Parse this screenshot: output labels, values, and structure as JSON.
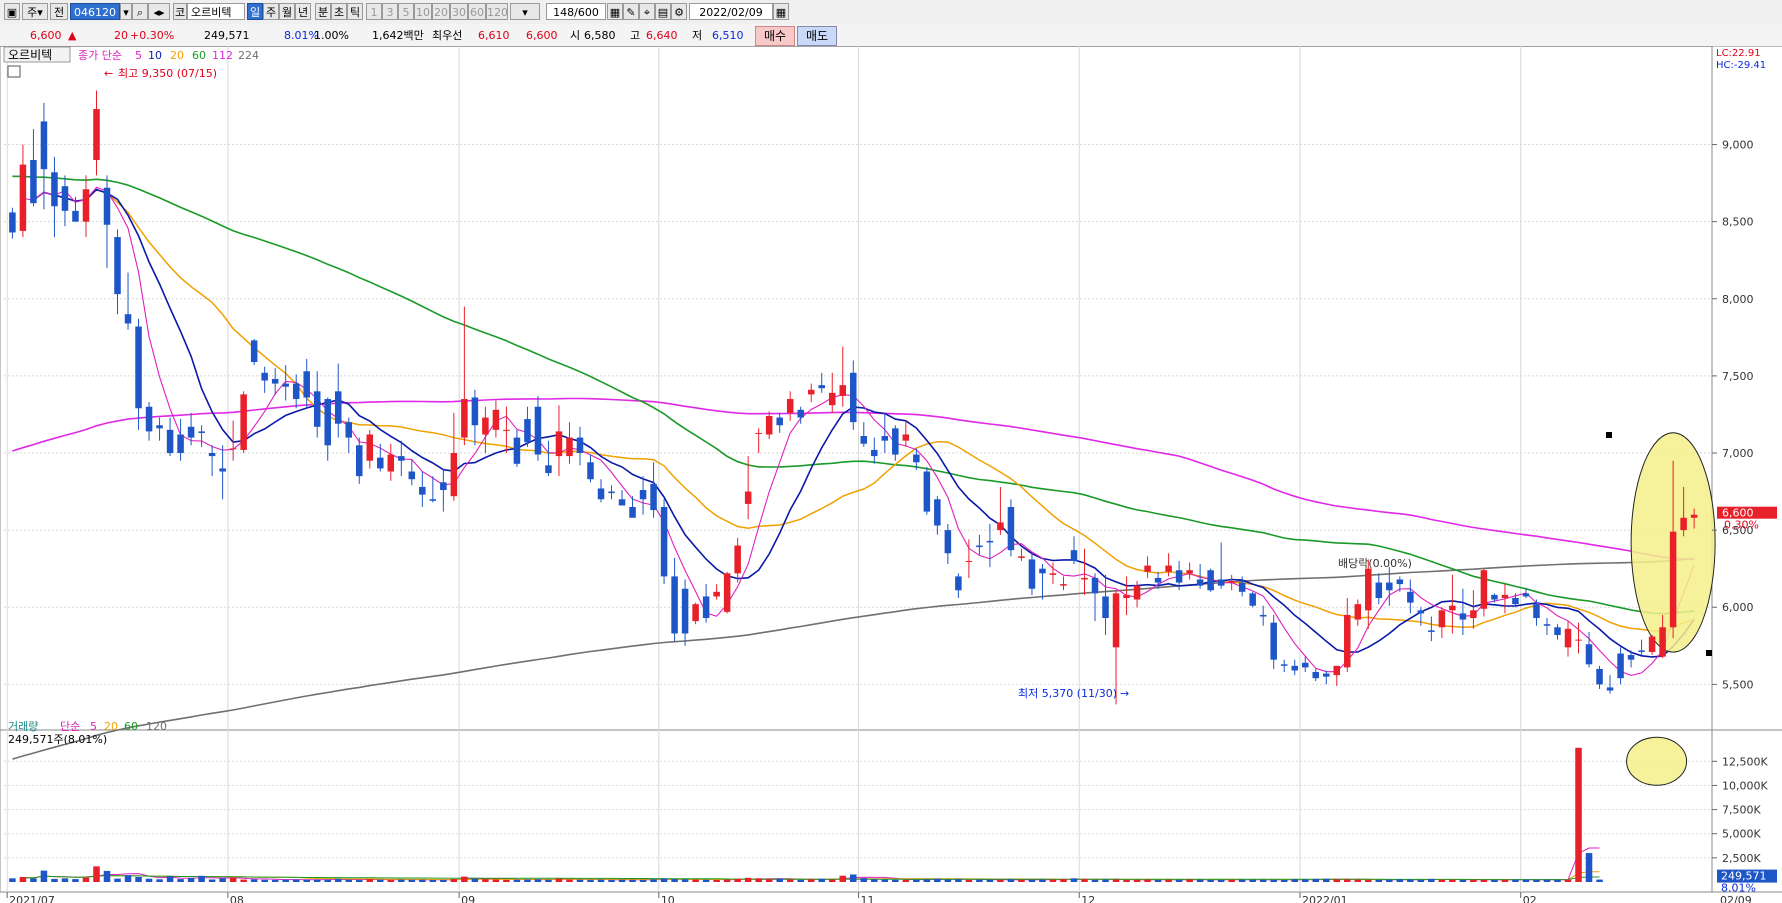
{
  "toolbar": {
    "period_type": "주",
    "market": "전",
    "code": "046120",
    "name_prefix": "코",
    "name": "오르비텍",
    "tabs": [
      "일",
      "주",
      "월",
      "년",
      "분",
      "초",
      "틱"
    ],
    "intervals": [
      "1",
      "3",
      "5",
      "10",
      "20",
      "30",
      "60",
      "120"
    ],
    "count": "148",
    "count_total": "/600",
    "date": "2022/02/09"
  },
  "quote": {
    "price": "6,600",
    "arrow": "▲",
    "change": "20",
    "change_pct": "+0.30%",
    "volume": "249,571",
    "turnover": "8.01%",
    "ratio": "1.00%",
    "amount": "1,642백만",
    "bid_label": "최우선",
    "bid1": "6,610",
    "bid2": "6,600",
    "open_label": "시",
    "open": "6,580",
    "high_label": "고",
    "high": "6,640",
    "low_label": "저",
    "low": "6,510",
    "buy": "매수",
    "sell": "매도"
  },
  "colors": {
    "up": "#e8202a",
    "down": "#1e56c8",
    "ma5": "#e020c0",
    "ma10": "#0a1aa8",
    "ma20": "#f0a000",
    "ma60": "#1a9a28",
    "ma112": "#e028e8",
    "ma224": "#707070",
    "grid": "#d8d8d8",
    "highlight": "#f4f08a"
  },
  "chart_data": [
    {
      "type": "candlestick",
      "title": "오르비텍",
      "legend_prefix": "종가 단순",
      "legend": [
        "5",
        "10",
        "20",
        "60",
        "112",
        "224"
      ],
      "y_ticks": [
        5500,
        6000,
        6500,
        7000,
        7500,
        8000,
        8500,
        9000
      ],
      "y_tick_labels": [
        "5,500",
        "6,000",
        "6,500",
        "7,000",
        "7,500",
        "8,000",
        "8,500",
        "9,000"
      ],
      "ylim": [
        5230,
        9600
      ],
      "x_labels": [
        "2021/07",
        "08",
        "09",
        "10",
        "11",
        "12",
        "2022/01",
        "02",
        "02/09"
      ],
      "x_label_index": [
        0,
        21,
        43,
        62,
        81,
        102,
        123,
        144
      ],
      "high_annotation": "최고 9,350 (07/15)",
      "low_annotation": "최저 5,370 (11/30)",
      "dividend_annotation": "배당락(0.00%)",
      "top_right": [
        "LC:22.91",
        "HC:-29.41"
      ],
      "last_price_label": "6,600",
      "last_change_label": "0.30%",
      "candles": [
        [
          8560,
          8590,
          8390,
          8430
        ],
        [
          8440,
          9000,
          8400,
          8870
        ],
        [
          8900,
          9100,
          8600,
          8620
        ],
        [
          9150,
          9270,
          8580,
          8840
        ],
        [
          8820,
          8920,
          8400,
          8600
        ],
        [
          8730,
          8800,
          8470,
          8570
        ],
        [
          8570,
          8660,
          8500,
          8500
        ],
        [
          8500,
          8800,
          8400,
          8710
        ],
        [
          8900,
          9350,
          8800,
          9230
        ],
        [
          8720,
          8800,
          8200,
          8480
        ],
        [
          8400,
          8450,
          7900,
          8030
        ],
        [
          7900,
          8170,
          7800,
          7840
        ],
        [
          7820,
          7870,
          7150,
          7290
        ],
        [
          7300,
          7330,
          7080,
          7140
        ],
        [
          7180,
          7230,
          7080,
          7160
        ],
        [
          7150,
          7230,
          6980,
          7000
        ],
        [
          7120,
          7220,
          6950,
          7000
        ],
        [
          7170,
          7260,
          7050,
          7100
        ],
        [
          7140,
          7180,
          7040,
          7130
        ],
        [
          7000,
          7050,
          6850,
          6980
        ],
        [
          6900,
          7050,
          6700,
          6880
        ],
        [
          7030,
          7210,
          6950,
          7030
        ],
        [
          7020,
          7400,
          7000,
          7380
        ],
        [
          7730,
          7740,
          7570,
          7590
        ],
        [
          7520,
          7560,
          7390,
          7470
        ],
        [
          7480,
          7550,
          7380,
          7450
        ],
        [
          7450,
          7570,
          7340,
          7430
        ],
        [
          7450,
          7510,
          7290,
          7350
        ],
        [
          7530,
          7610,
          7290,
          7360
        ],
        [
          7400,
          7530,
          7100,
          7170
        ],
        [
          7350,
          7360,
          6950,
          7050
        ],
        [
          7400,
          7580,
          7100,
          7190
        ],
        [
          7200,
          7230,
          7000,
          7100
        ],
        [
          7050,
          7100,
          6800,
          6850
        ],
        [
          6950,
          7150,
          6900,
          7120
        ],
        [
          6970,
          7060,
          6880,
          6900
        ],
        [
          6880,
          7060,
          6820,
          6990
        ],
        [
          6980,
          7080,
          6850,
          6950
        ],
        [
          6880,
          6960,
          6790,
          6830
        ],
        [
          6780,
          6880,
          6650,
          6730
        ],
        [
          6700,
          6850,
          6680,
          6690
        ],
        [
          6810,
          6900,
          6620,
          6760
        ],
        [
          6720,
          7260,
          6690,
          7000
        ],
        [
          7100,
          7950,
          7050,
          7350
        ],
        [
          7360,
          7410,
          7050,
          7180
        ],
        [
          7120,
          7300,
          7000,
          7230
        ],
        [
          7150,
          7340,
          7100,
          7280
        ],
        [
          7150,
          7300,
          7000,
          7150
        ],
        [
          7100,
          7150,
          6910,
          6930
        ],
        [
          7220,
          7300,
          7040,
          7070
        ],
        [
          7300,
          7370,
          6950,
          6990
        ],
        [
          6920,
          7080,
          6850,
          6870
        ],
        [
          6980,
          7310,
          6850,
          7140
        ],
        [
          6980,
          7200,
          6930,
          7100
        ],
        [
          7100,
          7170,
          6920,
          7000
        ],
        [
          6940,
          6990,
          6810,
          6830
        ],
        [
          6770,
          6830,
          6680,
          6700
        ],
        [
          6750,
          6790,
          6700,
          6740
        ],
        [
          6700,
          6760,
          6660,
          6660
        ],
        [
          6650,
          6720,
          6600,
          6580
        ],
        [
          6760,
          6850,
          6600,
          6700
        ],
        [
          6800,
          6940,
          6580,
          6630
        ],
        [
          6650,
          6700,
          6150,
          6200
        ],
        [
          6200,
          6320,
          5780,
          5830
        ],
        [
          6120,
          6180,
          5750,
          5830
        ],
        [
          5910,
          6030,
          5890,
          6020
        ],
        [
          6070,
          6150,
          5900,
          5930
        ],
        [
          6070,
          6150,
          6050,
          6100
        ],
        [
          5970,
          6230,
          5960,
          6220
        ],
        [
          6220,
          6450,
          6160,
          6400
        ],
        [
          6670,
          6980,
          6570,
          6750
        ],
        [
          7130,
          7160,
          7000,
          7130
        ],
        [
          7120,
          7270,
          7090,
          7240
        ],
        [
          7230,
          7260,
          7130,
          7180
        ],
        [
          7260,
          7400,
          7210,
          7350
        ],
        [
          7280,
          7300,
          7190,
          7230
        ],
        [
          7380,
          7450,
          7330,
          7410
        ],
        [
          7440,
          7520,
          7390,
          7420
        ],
        [
          7310,
          7520,
          7260,
          7390
        ],
        [
          7370,
          7690,
          7300,
          7440
        ],
        [
          7520,
          7600,
          7150,
          7200
        ],
        [
          7110,
          7200,
          7040,
          7060
        ],
        [
          7020,
          7100,
          6930,
          6980
        ],
        [
          7110,
          7260,
          7000,
          7080
        ],
        [
          7160,
          7180,
          6950,
          6990
        ],
        [
          7080,
          7210,
          7040,
          7120
        ],
        [
          6990,
          7030,
          6890,
          6940
        ],
        [
          6880,
          6910,
          6600,
          6620
        ],
        [
          6700,
          6720,
          6470,
          6530
        ],
        [
          6500,
          6540,
          6280,
          6350
        ],
        [
          6200,
          6220,
          6060,
          6110
        ],
        [
          6300,
          6440,
          6190,
          6300
        ],
        [
          6400,
          6470,
          6340,
          6390
        ],
        [
          6430,
          6540,
          6260,
          6420
        ],
        [
          6500,
          6780,
          6470,
          6550
        ],
        [
          6650,
          6700,
          6330,
          6370
        ],
        [
          6320,
          6380,
          6300,
          6330
        ],
        [
          6310,
          6350,
          6080,
          6120
        ],
        [
          6250,
          6280,
          6050,
          6220
        ],
        [
          6210,
          6290,
          6150,
          6220
        ],
        [
          6140,
          6200,
          6110,
          6150
        ],
        [
          6370,
          6460,
          6280,
          6300
        ],
        [
          6180,
          6380,
          6080,
          6190
        ],
        [
          6190,
          6220,
          5910,
          6090
        ],
        [
          6070,
          6210,
          5820,
          5930
        ],
        [
          5740,
          6110,
          5370,
          6090
        ],
        [
          6060,
          6200,
          5950,
          6080
        ],
        [
          6050,
          6170,
          6000,
          6140
        ],
        [
          6230,
          6330,
          6190,
          6270
        ],
        [
          6190,
          6230,
          6120,
          6160
        ],
        [
          6230,
          6350,
          6200,
          6270
        ],
        [
          6240,
          6300,
          6110,
          6160
        ],
        [
          6220,
          6290,
          6180,
          6240
        ],
        [
          6180,
          6280,
          6120,
          6140
        ],
        [
          6240,
          6250,
          6100,
          6110
        ],
        [
          6180,
          6420,
          6120,
          6140
        ],
        [
          6160,
          6210,
          6110,
          6170
        ],
        [
          6160,
          6200,
          6070,
          6100
        ],
        [
          6090,
          6100,
          6000,
          6010
        ],
        [
          5950,
          6010,
          5880,
          5940
        ],
        [
          5900,
          5950,
          5600,
          5660
        ],
        [
          5630,
          5660,
          5580,
          5620
        ],
        [
          5620,
          5660,
          5560,
          5590
        ],
        [
          5640,
          5680,
          5580,
          5610
        ],
        [
          5580,
          5600,
          5520,
          5540
        ],
        [
          5570,
          5590,
          5500,
          5550
        ],
        [
          5560,
          5620,
          5490,
          5620
        ],
        [
          5610,
          6060,
          5580,
          5950
        ],
        [
          5920,
          6050,
          5880,
          6020
        ],
        [
          5980,
          6310,
          5860,
          6250
        ],
        [
          6160,
          6220,
          6020,
          6060
        ],
        [
          6160,
          6260,
          6010,
          6110
        ],
        [
          6180,
          6200,
          6100,
          6150
        ],
        [
          6100,
          6180,
          5960,
          6030
        ],
        [
          5980,
          6000,
          5880,
          5960
        ],
        [
          5850,
          5940,
          5780,
          5840
        ],
        [
          5870,
          6000,
          5800,
          5980
        ],
        [
          5980,
          6210,
          5830,
          6010
        ],
        [
          5960,
          6120,
          5820,
          5920
        ],
        [
          5930,
          6110,
          5860,
          5980
        ],
        [
          5990,
          6250,
          5940,
          6240
        ],
        [
          6080,
          6090,
          6030,
          6050
        ],
        [
          6060,
          6150,
          5960,
          6080
        ],
        [
          6060,
          6090,
          6000,
          6020
        ],
        [
          6090,
          6120,
          6060,
          6070
        ],
        [
          6020,
          6050,
          5880,
          5930
        ],
        [
          5890,
          5930,
          5820,
          5880
        ],
        [
          5870,
          5890,
          5790,
          5820
        ],
        [
          5740,
          5910,
          5680,
          5860
        ],
        [
          5790,
          5900,
          5700,
          5790
        ],
        [
          5760,
          5840,
          5610,
          5630
        ],
        [
          5600,
          5620,
          5470,
          5500
        ],
        [
          5480,
          5560,
          5440,
          5460
        ],
        [
          5700,
          5740,
          5500,
          5540
        ],
        [
          5690,
          5720,
          5610,
          5660
        ],
        [
          5720,
          5790,
          5690,
          5710
        ],
        [
          5710,
          5820,
          5690,
          5810
        ],
        [
          5680,
          5950,
          5670,
          5870
        ],
        [
          5870,
          6950,
          5800,
          6490
        ],
        [
          6500,
          6780,
          6460,
          6580
        ],
        [
          6580,
          6640,
          6510,
          6600
        ]
      ]
    },
    {
      "type": "bar",
      "title": "거래량",
      "legend_prefix": "단순",
      "legend": [
        "5",
        "20",
        "60",
        "120"
      ],
      "current_label": "249,571주(8.01%)",
      "y_ticks": [
        2500,
        5000,
        7500,
        10000,
        12500
      ],
      "y_tick_labels": [
        "2,500K",
        "5,000K",
        "7,500K",
        "10,000K",
        "12,500K"
      ],
      "ylim": [
        0,
        14500
      ],
      "value_label": "249,571",
      "pct_label": "8.01%",
      "values": [
        380,
        520,
        380,
        1180,
        320,
        380,
        300,
        450,
        1620,
        1150,
        350,
        700,
        520,
        340,
        280,
        600,
        300,
        420,
        640,
        260,
        380,
        460,
        250,
        280,
        230,
        220,
        240,
        260,
        230,
        250,
        240,
        330,
        240,
        210,
        300,
        240,
        220,
        250,
        230,
        240,
        210,
        220,
        300,
        560,
        330,
        300,
        260,
        220,
        240,
        260,
        280,
        240,
        350,
        260,
        240,
        230,
        250,
        220,
        240,
        230,
        220,
        280,
        360,
        300,
        280,
        250,
        230,
        210,
        250,
        330,
        430,
        380,
        280,
        340,
        260,
        230,
        280,
        320,
        260,
        650,
        780,
        400,
        280,
        250,
        230,
        240,
        220,
        280,
        340,
        260,
        300,
        220,
        240,
        230,
        220,
        280,
        230,
        220,
        240,
        250,
        290,
        380,
        300,
        220,
        250,
        260,
        220,
        230,
        250,
        220,
        240,
        230,
        260,
        240,
        220,
        220,
        230,
        240,
        240,
        230,
        220,
        210,
        280,
        260,
        320,
        330,
        280,
        270,
        240,
        230,
        220,
        240,
        270,
        250,
        230,
        320,
        230,
        240,
        220,
        230,
        210,
        220,
        230,
        240,
        250,
        230,
        240,
        230,
        240,
        13900,
        3000,
        250
      ]
    }
  ]
}
